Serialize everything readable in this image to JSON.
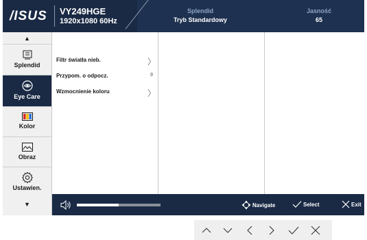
{
  "header": {
    "brand": "/ISUS",
    "model": "VY249HGE",
    "resolution": "1920x1080 60Hz",
    "mode_label": "Splendid",
    "mode_value": "Tryb Standardowy",
    "brightness_label": "Jasność",
    "brightness_value": "65"
  },
  "sidebar": {
    "items": [
      {
        "label": "Splendid",
        "icon": "splendid-icon"
      },
      {
        "label": "Eye Care",
        "icon": "eye-icon",
        "active": true
      },
      {
        "label": "Kolor",
        "icon": "color-bars-icon"
      },
      {
        "label": "Obraz",
        "icon": "image-icon"
      },
      {
        "label": "Ustawien.",
        "icon": "gear-icon"
      }
    ]
  },
  "menu": {
    "options": [
      {
        "label": "Filtr światła nieb.",
        "indicator": "chevron-right-icon"
      },
      {
        "label": "Przypom. o odpocz.",
        "value": "0"
      },
      {
        "label": "Wzmocnienie koloru",
        "indicator": "chevron-right-icon"
      }
    ]
  },
  "footer": {
    "volume_level": 0.5,
    "navigate_label": "Navigate",
    "select_label": "Select",
    "exit_label": "Exit"
  },
  "keys": [
    "chevron-up-icon",
    "chevron-down-icon",
    "chevron-left-icon",
    "chevron-right-icon",
    "check-icon",
    "close-icon"
  ],
  "colors": {
    "header_bg": "#1a2a45",
    "active_bg": "#1a2a45",
    "accent_label": "#8fa5c5"
  }
}
